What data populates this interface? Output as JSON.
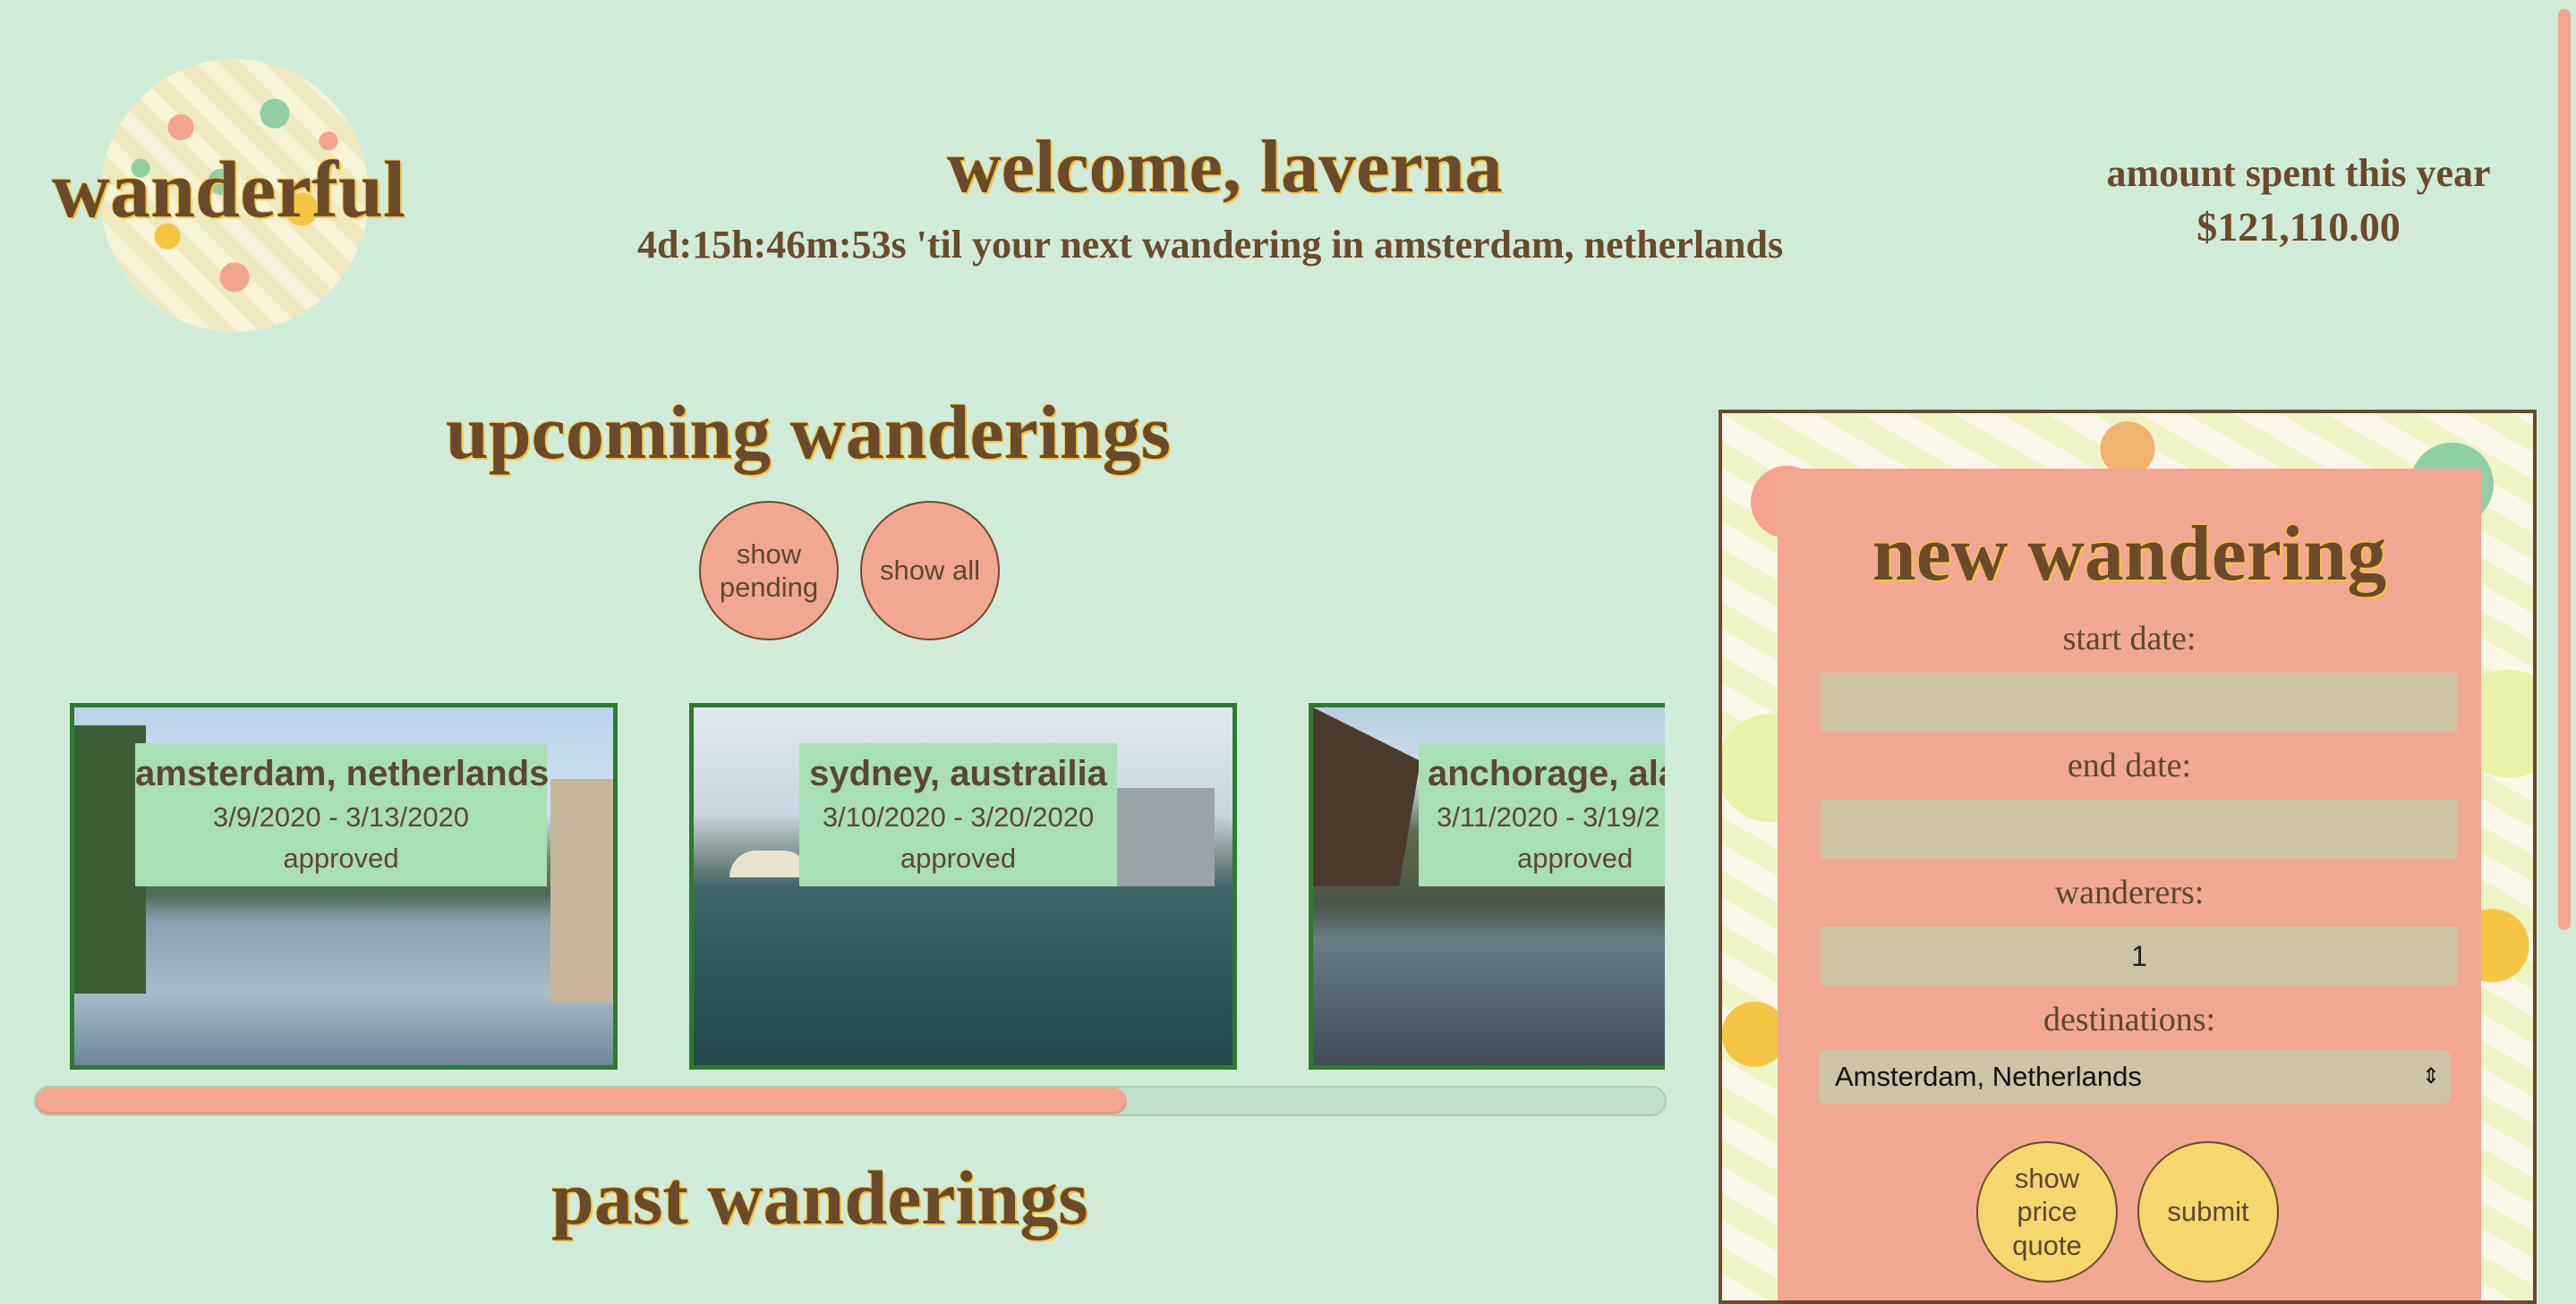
{
  "header": {
    "logo_text": "wanderful",
    "welcome": "welcome, laverna",
    "countdown": "4d:15h:46m:53s 'til your next wandering in amsterdam, netherlands",
    "spent_label": "amount spent this year",
    "spent_value": "$121,110.00"
  },
  "upcoming": {
    "title": "upcoming wanderings",
    "filters": {
      "pending_label": "show pending",
      "all_label": "show all"
    },
    "trips": [
      {
        "destination": "amsterdam, netherlands",
        "dates": "3/9/2020 - 3/13/2020",
        "status": "approved"
      },
      {
        "destination": "sydney, austrailia",
        "dates": "3/10/2020 - 3/20/2020",
        "status": "approved"
      },
      {
        "destination": "anchorage, ala",
        "dates": "3/11/2020 - 3/19/2",
        "status": "approved"
      }
    ],
    "scroll_position_fraction": 0.37
  },
  "past": {
    "title": "past wanderings"
  },
  "new_wandering": {
    "title": "new wandering",
    "start_label": "start date:",
    "start_value": "",
    "end_label": "end date:",
    "end_value": "",
    "wanderers_label": "wanderers:",
    "wanderers_value": "1",
    "destinations_label": "destinations:",
    "destination_selected": "Amsterdam, Netherlands",
    "quote_label": "show price quote",
    "submit_label": "submit"
  },
  "colors": {
    "background": "#d0ecd9",
    "accent_salmon": "#f2a793",
    "accent_yellow": "#f5d76e",
    "text_brown": "#6b4a2b",
    "card_border": "#2f7a2f"
  }
}
